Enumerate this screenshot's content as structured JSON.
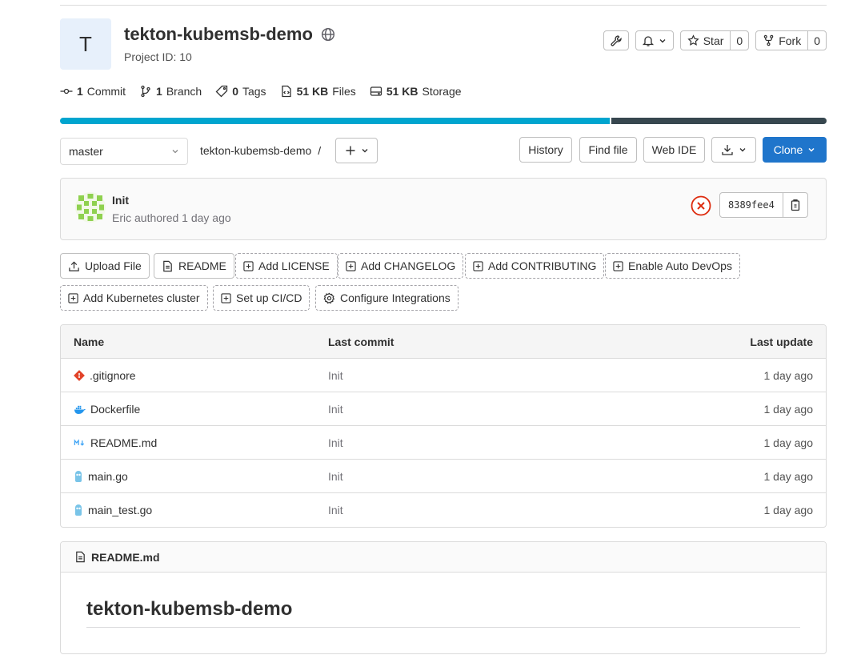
{
  "project": {
    "avatar_letter": "T",
    "name": "tekton-kubemsb-demo",
    "id_text": "Project ID: 10",
    "visibility_icon": "globe-icon"
  },
  "header_actions": {
    "settings_icon": "wrench-icon",
    "notifications_icon": "bell-icon",
    "star_label": "Star",
    "star_count": "0",
    "fork_label": "Fork",
    "fork_count": "0"
  },
  "stats": {
    "commits_count": "1",
    "commits_label": "Commit",
    "branches_count": "1",
    "branches_label": "Branch",
    "tags_count": "0",
    "tags_label": "Tags",
    "files_size": "51 KB",
    "files_label": "Files",
    "storage_size": "51 KB",
    "storage_label": "Storage"
  },
  "languages": {
    "primary_fraction": 0.717,
    "colors": [
      "#00a5cf",
      "#37474f"
    ]
  },
  "toolbar": {
    "branch": "master",
    "breadcrumb_project": "tekton-kubemsb-demo",
    "breadcrumb_sep": "/",
    "history": "History",
    "find_file": "Find file",
    "web_ide": "Web IDE",
    "clone": "Clone"
  },
  "last_commit": {
    "title": "Init",
    "author_line": "Eric authored 1 day ago",
    "sha": "8389fee4",
    "pipeline_status": "failed"
  },
  "quick_actions": {
    "upload_file": "Upload File",
    "readme": "README",
    "add_license": "Add LICENSE",
    "add_changelog": "Add CHANGELOG",
    "add_contributing": "Add CONTRIBUTING",
    "enable_auto_devops": "Enable Auto DevOps",
    "add_k8s": "Add Kubernetes cluster",
    "setup_cicd": "Set up CI/CD",
    "configure_integrations": "Configure Integrations"
  },
  "file_table": {
    "headers": {
      "name": "Name",
      "last_commit": "Last commit",
      "last_update": "Last update"
    },
    "rows": [
      {
        "name": ".gitignore",
        "commit": "Init",
        "updated": "1 day ago",
        "icon": "git-icon"
      },
      {
        "name": "Dockerfile",
        "commit": "Init",
        "updated": "1 day ago",
        "icon": "docker-icon"
      },
      {
        "name": "README.md",
        "commit": "Init",
        "updated": "1 day ago",
        "icon": "markdown-icon"
      },
      {
        "name": "main.go",
        "commit": "Init",
        "updated": "1 day ago",
        "icon": "go-icon"
      },
      {
        "name": "main_test.go",
        "commit": "Init",
        "updated": "1 day ago",
        "icon": "go-icon"
      }
    ]
  },
  "readme": {
    "filename": "README.md",
    "heading": "tekton-kubemsb-demo"
  },
  "colors": {
    "accent": "#1f75cb",
    "failed": "#dd2b0e",
    "avatar_bg": "#e7f0fb"
  }
}
